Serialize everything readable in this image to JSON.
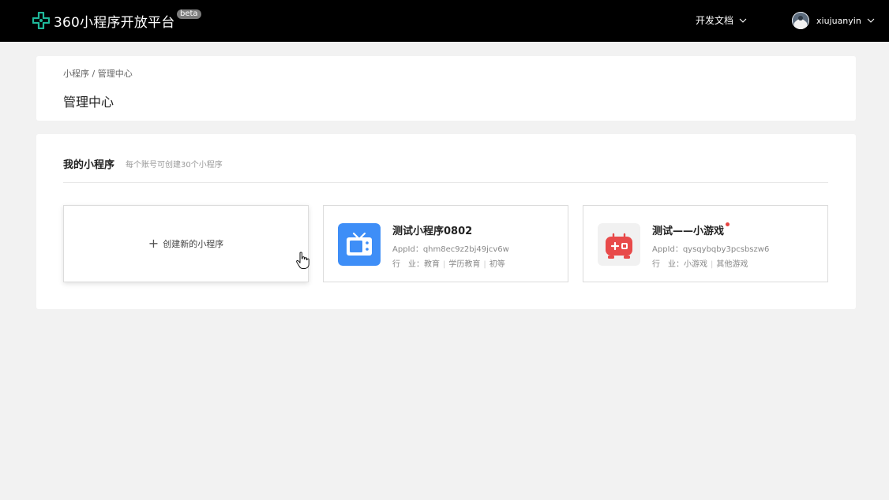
{
  "header": {
    "logo_text": "360小程序开放平台",
    "beta_label": "beta",
    "docs_label": "开发文档",
    "username": "xiujuanyin"
  },
  "breadcrumb": {
    "item1": "小程序",
    "separator": " / ",
    "item2": "管理中心"
  },
  "page_title": "管理中心",
  "section": {
    "title": "我的小程序",
    "hint": "每个账号可创建30个小程序"
  },
  "create_card": {
    "label": "创建新的小程序"
  },
  "apps": [
    {
      "name": "测试小程序0802",
      "appid": "AppId：qhm8ec9z2bj49jcv6w",
      "industry_label": "行　业：",
      "industry_tags": [
        "教育",
        "学历教育",
        "初等"
      ],
      "icon": "tv-icon",
      "icon_color": "#3e8ef7"
    },
    {
      "name": "测试——小游戏",
      "appid": "AppId：qysqybqby3pcsbszw6",
      "industry_label": "行　业：",
      "industry_tags": [
        "小游戏",
        "其他游戏"
      ],
      "icon": "gamepad-icon",
      "icon_color": "#e84a4a",
      "has_dot": true
    }
  ],
  "colors": {
    "topbar_bg": "#000000",
    "logo_accent": "#1fb89a",
    "page_bg": "#f2f2f2",
    "dot_red": "#e64340"
  }
}
